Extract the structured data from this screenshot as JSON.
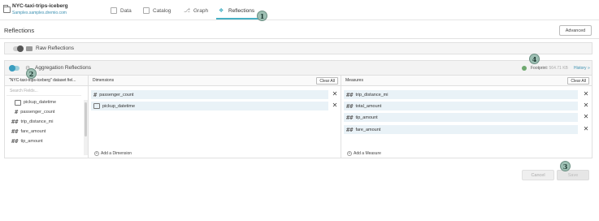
{
  "header": {
    "dataset_name": "NYC-taxi-trips-iceberg",
    "dataset_path": "Samples.samples.dremio.com",
    "tabs": [
      {
        "label": "Data"
      },
      {
        "label": "Catalog"
      },
      {
        "label": "Graph"
      },
      {
        "label": "Reflections"
      }
    ]
  },
  "page": {
    "title": "Reflections",
    "advanced_label": "Advanced"
  },
  "raw": {
    "title": "Raw Reflections"
  },
  "agg": {
    "title": "Aggregation Reflections",
    "footprint_label": "Footprint:",
    "footprint_value": "564.71 KB",
    "history_label": "History »"
  },
  "fields_panel": {
    "header": "\"NYC-taxi-trips-iceberg\" dataset fiel...",
    "search_placeholder": "Search Fields...",
    "items": [
      {
        "label": "pickup_datetime",
        "icon": "calendar-icon"
      },
      {
        "label": "passenger_count",
        "icon": "hash-icon"
      },
      {
        "label": "trip_distance_mi",
        "icon": "double-hash-icon"
      },
      {
        "label": "fare_amount",
        "icon": "double-hash-icon"
      },
      {
        "label": "tip_amount",
        "icon": "double-hash-icon"
      }
    ]
  },
  "dimensions": {
    "header": "Dimensions",
    "clear_label": "Clear All",
    "items": [
      {
        "label": "passenger_count",
        "icon": "hash-icon"
      },
      {
        "label": "pickup_datetime",
        "icon": "calendar-icon"
      }
    ],
    "add_label": "Add a Dimension"
  },
  "measures": {
    "header": "Measures",
    "clear_label": "Clear All",
    "items": [
      {
        "label": "trip_distance_mi",
        "icon": "double-hash-icon"
      },
      {
        "label": "total_amount",
        "icon": "double-hash-icon"
      },
      {
        "label": "tip_amount",
        "icon": "double-hash-icon"
      },
      {
        "label": "fare_amount",
        "icon": "double-hash-icon"
      }
    ],
    "add_label": "Add a Measure"
  },
  "footer": {
    "cancel_label": "Cancel",
    "save_label": "Save"
  },
  "callouts": [
    "1",
    "2",
    "3",
    "4"
  ],
  "icons": {
    "hash": "#",
    "double_hash": "##",
    "close": "✕"
  },
  "colors": {
    "accent": "#47b0c4",
    "link": "#3a8fb0",
    "row_highlight": "#e9f2f7"
  }
}
